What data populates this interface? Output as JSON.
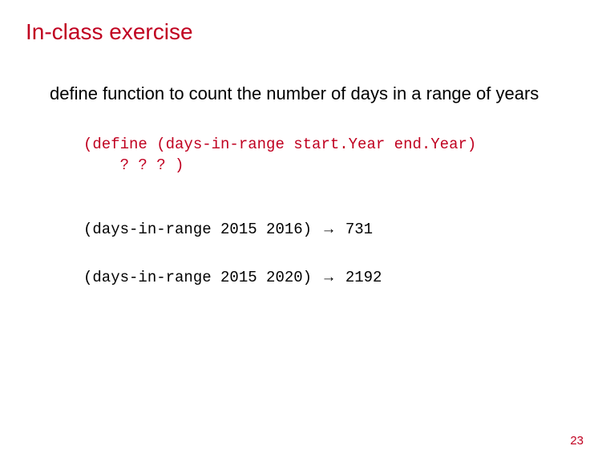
{
  "title": "In-class exercise",
  "subtitle": "define function to count the number of days in a range of years",
  "code": {
    "define_line1": "(define (days-in-range start.Year end.Year)",
    "define_line2": "    ? ? ? )",
    "example1_call": "(days-in-range 2015 2016) ",
    "example1_arrow": "→",
    "example1_result": " 731",
    "example2_call": "(days-in-range 2015 2020) ",
    "example2_arrow": "→",
    "example2_result": " 2192"
  },
  "page_number": "23"
}
